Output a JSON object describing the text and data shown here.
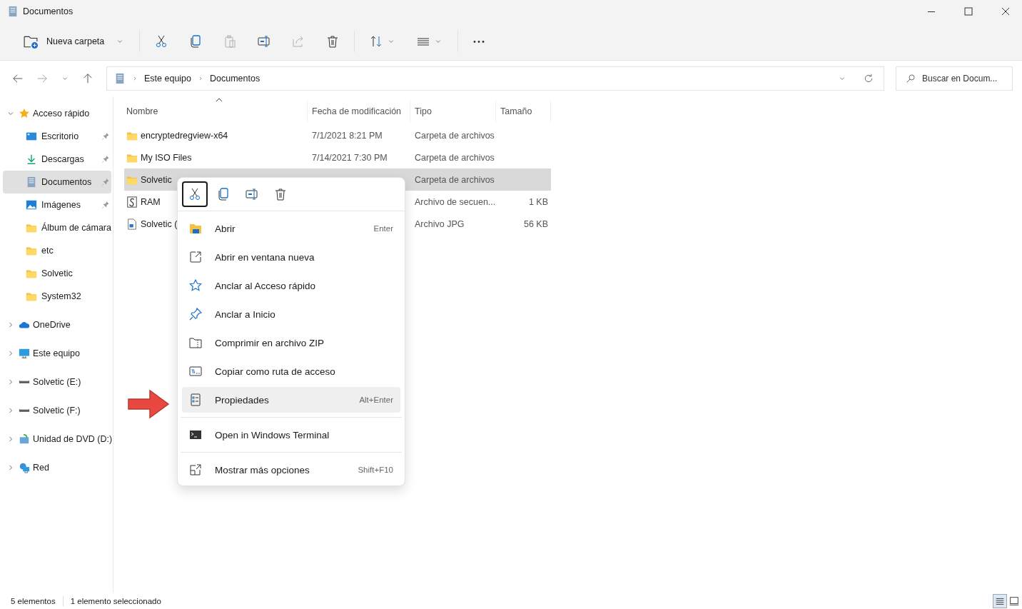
{
  "window": {
    "title": "Documentos"
  },
  "toolbar": {
    "new_label": "Nueva carpeta",
    "actions": [
      {
        "kind": "cut",
        "disabled": false
      },
      {
        "kind": "copy",
        "disabled": false
      },
      {
        "kind": "paste",
        "disabled": true
      },
      {
        "kind": "rename",
        "disabled": false
      },
      {
        "kind": "share",
        "disabled": true
      },
      {
        "kind": "delete",
        "disabled": false
      }
    ]
  },
  "address": {
    "path": [
      "Este equipo",
      "Documentos"
    ]
  },
  "search": {
    "placeholder": "Buscar en Docum..."
  },
  "sidebar": {
    "items": [
      {
        "kind": "star",
        "label": "Acceso rápido",
        "expanded": true,
        "selected": false,
        "children": [
          {
            "kind": "desktop",
            "label": "Escritorio",
            "pinned": true,
            "selected": false
          },
          {
            "kind": "download",
            "label": "Descargas",
            "pinned": true,
            "selected": false
          },
          {
            "kind": "document",
            "label": "Documentos",
            "pinned": true,
            "selected": true
          },
          {
            "kind": "images",
            "label": "Imágenes",
            "pinned": true,
            "selected": false
          },
          {
            "kind": "folder",
            "label": "Álbum de cámara",
            "pinned": false,
            "selected": false
          },
          {
            "kind": "folder",
            "label": "etc",
            "pinned": false,
            "selected": false
          },
          {
            "kind": "folder",
            "label": "Solvetic",
            "pinned": false,
            "selected": false
          },
          {
            "kind": "folder",
            "label": "System32",
            "pinned": false,
            "selected": false
          }
        ]
      },
      {
        "kind": "cloud",
        "label": "OneDrive",
        "expanded": false,
        "selected": false
      },
      {
        "kind": "pc",
        "label": "Este equipo",
        "expanded": false,
        "selected": false
      },
      {
        "kind": "drive",
        "label": "Solvetic (E:)",
        "expanded": false,
        "selected": false
      },
      {
        "kind": "drive",
        "label": "Solvetic (F:)",
        "expanded": false,
        "selected": false
      },
      {
        "kind": "dvd",
        "label": "Unidad de DVD (D:)",
        "expanded": false,
        "selected": false
      },
      {
        "kind": "network",
        "label": "Red",
        "expanded": false,
        "selected": false
      }
    ]
  },
  "table": {
    "columns": [
      {
        "label": "Nombre",
        "sorted": true
      },
      {
        "label": "Fecha de modificación",
        "sorted": false
      },
      {
        "label": "Tipo",
        "sorted": false
      },
      {
        "label": "Tamaño",
        "sorted": false
      }
    ],
    "rows": [
      {
        "kind": "folder",
        "name": "encryptedregview-x64",
        "date": "7/1/2021 8:21 PM",
        "type": "Carpeta de archivos",
        "selected": false
      },
      {
        "kind": "folder",
        "name": "My ISO Files",
        "date": "7/14/2021 7:30 PM",
        "type": "Carpeta de archivos",
        "selected": false
      },
      {
        "kind": "folder",
        "name": "Solvetic",
        "type": "Carpeta de archivos",
        "selected": true
      },
      {
        "kind": "script",
        "name": "RAM",
        "type": "Archivo de secuen...",
        "size": "1 KB",
        "selected": false
      },
      {
        "kind": "image",
        "name": "Solvetic (",
        "type": "Archivo JPG",
        "size": "56 KB",
        "selected": false
      }
    ]
  },
  "context_menu": {
    "quick_actions": [
      {
        "kind": "cut",
        "focused": true
      },
      {
        "kind": "copy",
        "focused": false
      },
      {
        "kind": "rename",
        "focused": false
      },
      {
        "kind": "delete",
        "focused": false
      }
    ],
    "items": [
      {
        "kind": "open",
        "label": "Abrir",
        "shortcut": "Enter",
        "highlighted": false,
        "separator_before": false
      },
      {
        "kind": "new-window",
        "label": "Abrir en ventana nueva",
        "highlighted": false,
        "separator_before": false
      },
      {
        "kind": "star",
        "label": "Anclar al Acceso rápido",
        "highlighted": false,
        "separator_before": false
      },
      {
        "kind": "pin",
        "label": "Anclar a Inicio",
        "highlighted": false,
        "separator_before": false
      },
      {
        "kind": "zip",
        "label": "Comprimir en archivo ZIP",
        "highlighted": false,
        "separator_before": false
      },
      {
        "kind": "path",
        "label": "Copiar como ruta de acceso",
        "highlighted": false,
        "separator_before": false
      },
      {
        "kind": "properties",
        "label": "Propiedades",
        "shortcut": "Alt+Enter",
        "highlighted": true,
        "separator_before": false
      },
      {
        "kind": "terminal",
        "label": "Open in Windows Terminal",
        "highlighted": false,
        "separator_before": true
      },
      {
        "kind": "more",
        "label": "Mostrar más opciones",
        "shortcut": "Shift+F10",
        "highlighted": false,
        "separator_before": true
      }
    ]
  },
  "status_bar": {
    "count": "5 elementos",
    "selection": "1 elemento seleccionado",
    "views": [
      {
        "kind": "details",
        "selected": true
      },
      {
        "kind": "tiles",
        "selected": false
      }
    ]
  }
}
